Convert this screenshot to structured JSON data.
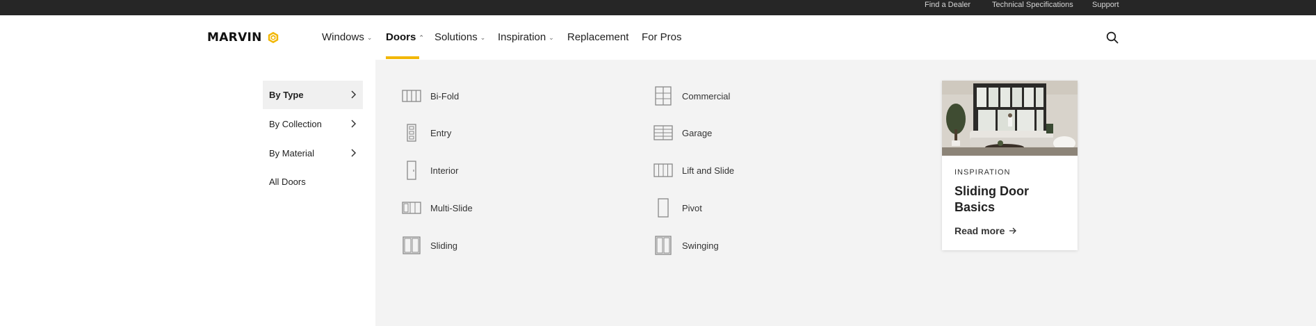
{
  "utility_bar": {
    "links": [
      "Find a Dealer",
      "Technical Specifications",
      "Support"
    ]
  },
  "header": {
    "logo_text": "MARVIN",
    "nav": [
      {
        "label": "Windows",
        "has_dropdown": true
      },
      {
        "label": "Doors",
        "has_dropdown": true,
        "active": true
      },
      {
        "label": "Solutions",
        "has_dropdown": true
      },
      {
        "label": "Inspiration",
        "has_dropdown": true
      },
      {
        "label": "Replacement",
        "has_dropdown": false
      },
      {
        "label": "For Pros",
        "has_dropdown": false
      }
    ],
    "search_icon": "search-icon",
    "accent_color": "#f2b705"
  },
  "menu": {
    "sidebar": [
      {
        "label": "By Type",
        "selected": true
      },
      {
        "label": "By Collection"
      },
      {
        "label": "By Material"
      },
      {
        "label": "All Doors"
      }
    ],
    "door_types_col1": [
      "Bi-Fold",
      "Entry",
      "Interior",
      "Multi-Slide",
      "Sliding"
    ],
    "door_types_col2": [
      "Commercial",
      "Garage",
      "Lift and Slide",
      "Pivot",
      "Swinging"
    ]
  },
  "promo_card": {
    "tag": "INSPIRATION",
    "title": "Sliding Door Basics",
    "link": "Read more"
  },
  "colors": {
    "top_bar": "#262626",
    "panel": "#f3f3f3",
    "accent": "#f2b705"
  }
}
